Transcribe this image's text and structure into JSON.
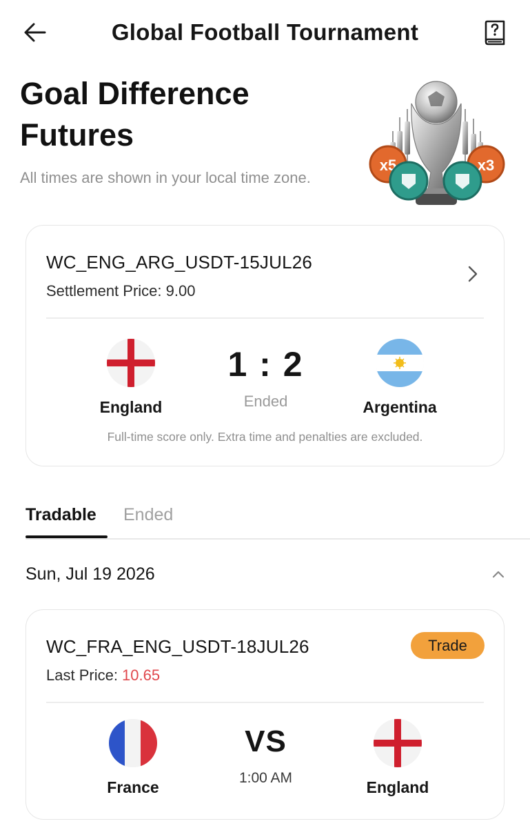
{
  "header": {
    "title": "Global Football Tournament",
    "back_icon": "arrow-left-icon",
    "help_icon": "help-book-icon"
  },
  "hero": {
    "title": "Goal Difference Futures",
    "subtitle": "All times are shown in your local time zone.",
    "artwork": {
      "chip_left": "x5",
      "chip_right": "x3"
    }
  },
  "settled_contract": {
    "symbol": "WC_ENG_ARG_USDT-15JUL26",
    "settlement_label": "Settlement Price: ",
    "settlement_value": "9.00",
    "home_team": "England",
    "away_team": "Argentina",
    "score": "1 : 2",
    "status": "Ended",
    "note": "Full-time score only. Extra time and penalties are excluded."
  },
  "tabs": [
    {
      "label": "Tradable",
      "active": true
    },
    {
      "label": "Ended",
      "active": false
    }
  ],
  "date_group": {
    "label": "Sun, Jul 19 2026",
    "expanded": true
  },
  "tradable_contract": {
    "symbol": "WC_FRA_ENG_USDT-18JUL26",
    "price_label": "Last Price: ",
    "price_value": "10.65",
    "action_label": "Trade",
    "home_team": "France",
    "away_team": "England",
    "vs_label": "VS",
    "kickoff": "1:00 AM"
  },
  "colors": {
    "accent_trade": "#f2a13c",
    "price_red": "#e0474c",
    "muted_text": "#8f8f8f"
  }
}
